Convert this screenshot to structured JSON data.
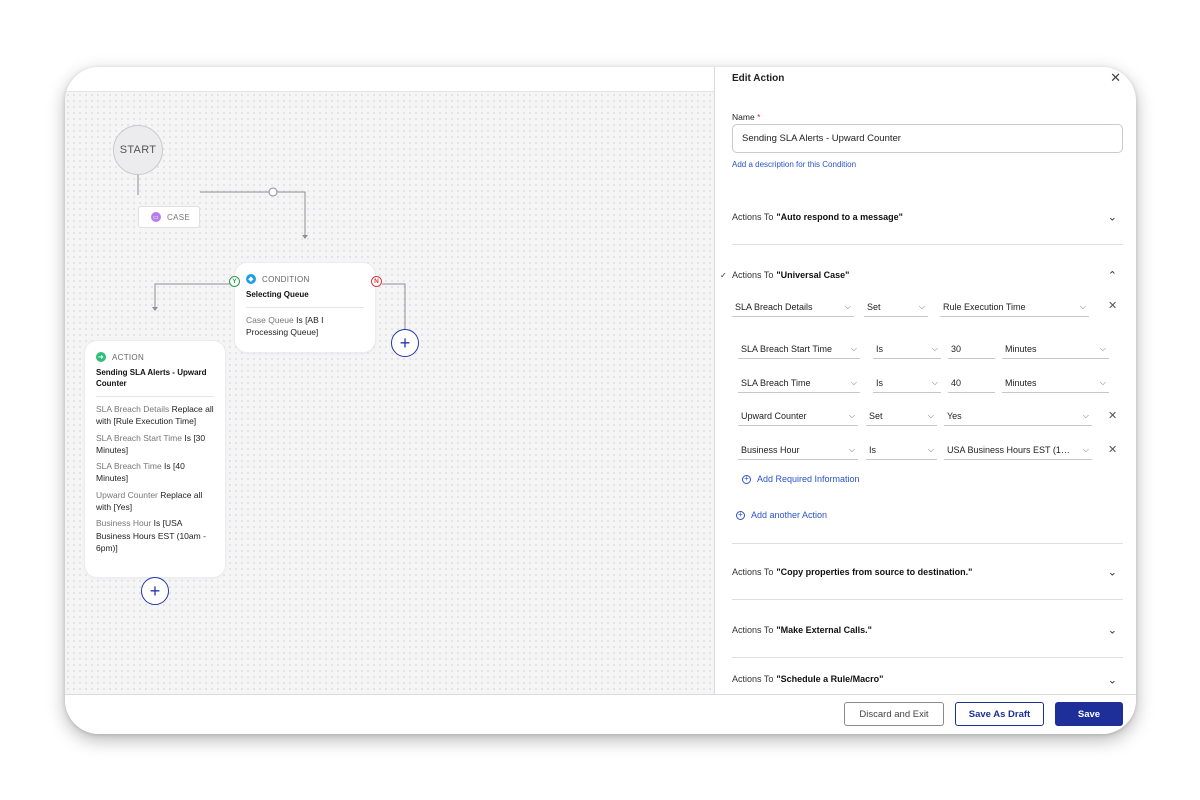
{
  "panel": {
    "title": "Edit Action",
    "close_icon": "close-icon",
    "name_label": "Name",
    "name_required_mark": "*",
    "name_value": "Sending SLA Alerts - Upward Counter",
    "description_link": "Add a description for this Condition",
    "actions_prefix": "Actions To",
    "sections": [
      {
        "target": "\"Auto respond to a message\"",
        "expanded": false
      },
      {
        "target": "\"Universal Case\"",
        "expanded": true
      },
      {
        "target": "\"Copy properties from source to destination.\"",
        "expanded": false
      },
      {
        "target": "\"Make External Calls.\"",
        "expanded": false
      },
      {
        "target": "\"Schedule a Rule/Macro\"",
        "expanded": false
      }
    ],
    "universal_case_rows": [
      {
        "field": "SLA Breach Details",
        "op": "Set",
        "value": "Rule Execution Time"
      },
      {
        "field": "SLA Breach Start Time",
        "op": "Is",
        "value": "30",
        "unit": "Minutes"
      },
      {
        "field": "SLA Breach Time",
        "op": "Is",
        "value": "40",
        "unit": "Minutes"
      },
      {
        "field": "Upward Counter",
        "op": "Set",
        "value": "Yes"
      },
      {
        "field": "Business Hour",
        "op": "Is",
        "value": "USA Business Hours EST (10..."
      }
    ],
    "add_required_info": "Add Required Information",
    "add_another_action": "Add another Action"
  },
  "canvas": {
    "start_label": "START",
    "case_label": "CASE",
    "condition_card": {
      "type": "CONDITION",
      "title": "Selecting Queue",
      "key": "Case Queue",
      "rest": " Is [AB I Processing Queue]",
      "yes_badge": "Y",
      "no_badge": "N"
    },
    "action_card": {
      "type": "ACTION",
      "title": "Sending SLA Alerts - Upward Counter",
      "lines": [
        {
          "key": "SLA Breach Details",
          "rest": " Replace all with [Rule Execution Time]"
        },
        {
          "key": "SLA Breach Start Time",
          "rest": " Is [30 Minutes]"
        },
        {
          "key": "SLA Breach Time",
          "rest": " Is [40 Minutes]"
        },
        {
          "key": "Upward Counter",
          "rest": " Replace all with [Yes]"
        },
        {
          "key": "Business Hour",
          "rest": " Is [USA Business Hours EST (10am - 6pm)]"
        }
      ]
    },
    "plus_symbol": "+"
  },
  "footer": {
    "discard_label": "Discard and Exit",
    "draft_label": "Save As Draft",
    "save_label": "Save"
  },
  "colors": {
    "primary": "#1e2f9a",
    "link": "#2a53c8",
    "yes": "#2e9d4f",
    "no": "#d23d3d"
  }
}
